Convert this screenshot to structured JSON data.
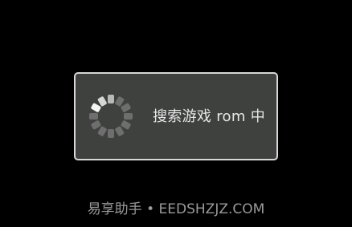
{
  "dialog": {
    "message": "搜索游戏 rom 中",
    "spinner_icon": "loading-spinner-icon"
  },
  "watermark": {
    "text": "易享助手 • EEDSHZJZ.COM"
  },
  "colors": {
    "background": "#000000",
    "dialog_background": "#3f413f",
    "dialog_border": "#d8d8d8",
    "text": "#e6e6e6",
    "watermark": "#9a9a9a"
  }
}
